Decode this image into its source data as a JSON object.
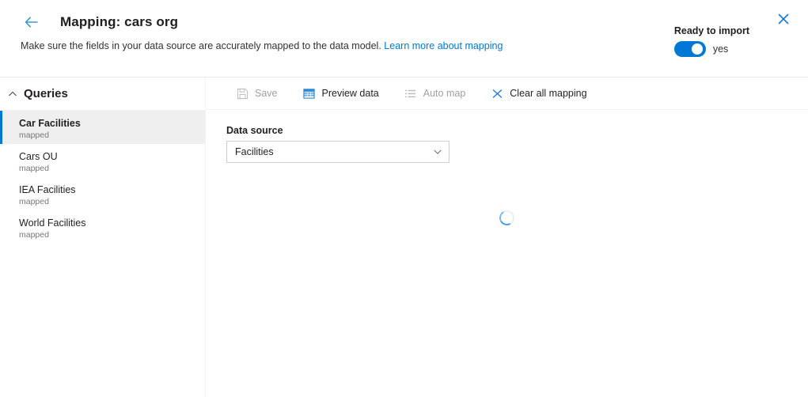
{
  "header": {
    "back_icon": "arrow-left-icon",
    "title": "Mapping: cars org",
    "subtitle_text": "Make sure the fields in your data source are accurately mapped to the data model.",
    "learn_more_link": "Learn more about mapping",
    "ready_label": "Ready to import",
    "toggle_state_text": "yes",
    "toggle_on": true,
    "close_icon": "close-icon",
    "accent_color": "#0078d4"
  },
  "sidebar": {
    "section_title": "Queries",
    "collapse_icon": "chevron-up-icon",
    "items": [
      {
        "label": "Car Facilities",
        "status": "mapped",
        "selected": true
      },
      {
        "label": "Cars OU",
        "status": "mapped",
        "selected": false
      },
      {
        "label": "IEA Facilities",
        "status": "mapped",
        "selected": false
      },
      {
        "label": "World Facilities",
        "status": "mapped",
        "selected": false
      }
    ]
  },
  "toolbar": {
    "save_label": "Save",
    "save_icon": "save-icon",
    "save_disabled": true,
    "preview_label": "Preview data",
    "preview_icon": "table-grid-icon",
    "preview_disabled": false,
    "automap_label": "Auto map",
    "automap_icon": "list-icon",
    "automap_disabled": true,
    "clear_label": "Clear all mapping",
    "clear_icon": "close-x-icon",
    "clear_disabled": false
  },
  "main": {
    "data_source_label": "Data source",
    "data_source_value": "Facilities",
    "data_source_caret_icon": "chevron-down-icon",
    "loading": true,
    "spinner_icon": "loading-spinner-icon"
  }
}
